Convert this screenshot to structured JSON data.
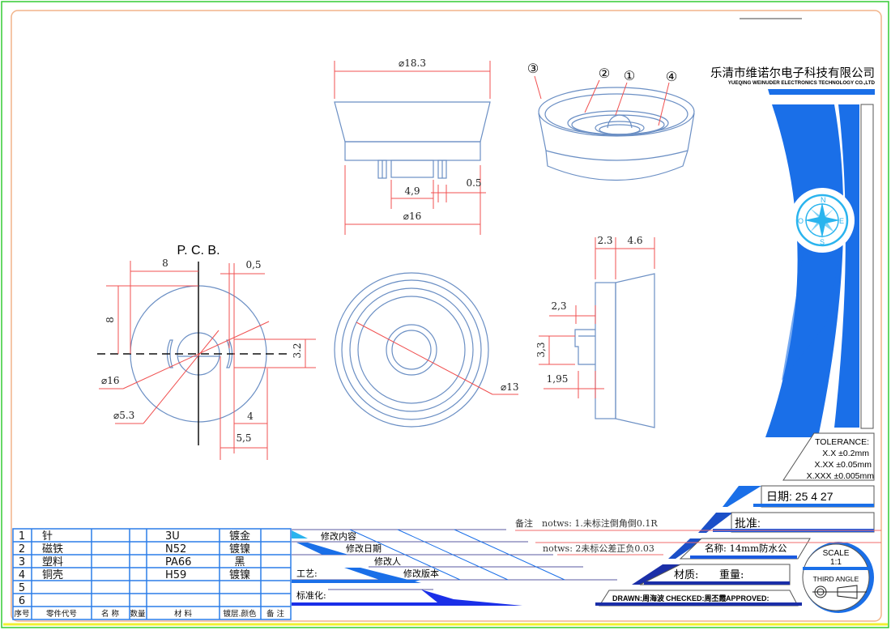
{
  "company": {
    "name_cn": "乐清市维诺尔电子科技有限公司",
    "name_en": "YUEQING WEINUDER ELECTRONICS TECHNOLOGY CO.,LTD"
  },
  "compass_letters": [
    "N",
    "E",
    "S",
    "O"
  ],
  "views": {
    "front": {
      "dia_top": "⌀18.3",
      "dia_bottom": "⌀16",
      "pin_span": "4,9",
      "pin_width": "0.5"
    },
    "iso": {
      "balloons": [
        "③",
        "②",
        "①",
        "④"
      ]
    },
    "pcb": {
      "title": "P. C. B.",
      "dim_h8": "8",
      "dim_v8": "8",
      "dim_05": "0,5",
      "dim_32": "3.2",
      "dia16": "⌀16",
      "dia53": "⌀5.3",
      "dim_4": "4",
      "dim_55": "5,5"
    },
    "top": {
      "dia13": "⌀13"
    },
    "side": {
      "d23": "2.3",
      "d46": "4.6",
      "d23b": "2,3",
      "d33": "3,3",
      "d195": "1,95"
    }
  },
  "bom": {
    "rows": [
      {
        "no": "1",
        "part": "针",
        "material": "3U",
        "finish": "镀金"
      },
      {
        "no": "2",
        "part": "磁铁",
        "material": "N52",
        "finish": "镀镍"
      },
      {
        "no": "3",
        "part": "塑料",
        "material": "PA66",
        "finish": "黑"
      },
      {
        "no": "4",
        "part": "铜壳",
        "material": "H59",
        "finish": "镀镍"
      },
      {
        "no": "5",
        "part": "",
        "material": "",
        "finish": ""
      },
      {
        "no": "6",
        "part": "",
        "material": "",
        "finish": ""
      }
    ],
    "headers": [
      "序号",
      "零件代号",
      "名 称",
      "数量",
      "材  料",
      "镀层.颜色",
      "备 注"
    ]
  },
  "revision": {
    "content": "修改内容",
    "date": "修改日期",
    "person": "修改人",
    "process": "工艺:",
    "version": "修改版本",
    "standard": "标准化:"
  },
  "notes": {
    "label": "备注",
    "note1": "notws: 1.未标注倒角倒0.1R",
    "note2": "notws: 2未标公差正负0.03"
  },
  "title_block": {
    "tolerance_title": "TOLERANCE:",
    "tolerances": [
      "X.X  ±0.2mm",
      "X.XX  ±0.05mm",
      "X.XXX  ±0.005mm"
    ],
    "date": "日期: 25  4  27",
    "approve": "批准:",
    "name": "名称: 14mm防水公",
    "material": "材质:",
    "weight": "重量:",
    "drawn": "DRAWN:周海波",
    "checked": "CHECKED:周丕霞",
    "approved": "APPROVED:",
    "scale_label": "SCALE",
    "scale": "1:1",
    "projection": "THIRD ANGLE"
  },
  "colors": {
    "part_line": "#6b8fc4",
    "dimension": "#f05050",
    "accent_blue": "#1a6fe8",
    "dark_blue": "#1b2fa8",
    "frame_green": "#33cc33",
    "frame_orange": "#f2b48a"
  }
}
